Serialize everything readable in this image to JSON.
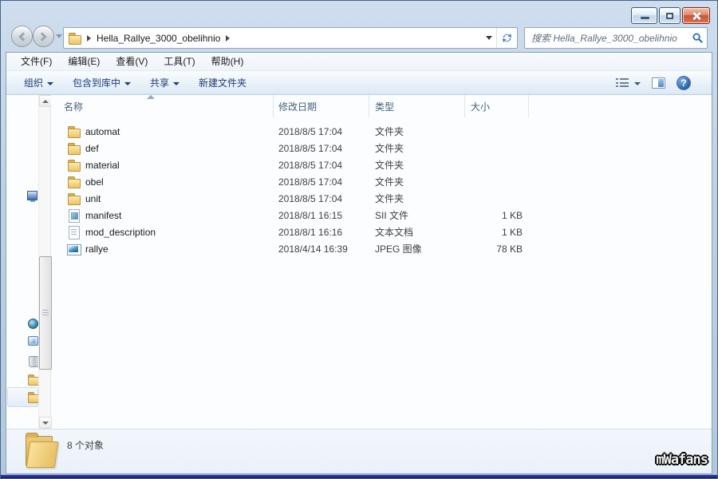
{
  "address_bar": {
    "breadcrumb_folder": "Hella_Rallye_3000_obelihnio"
  },
  "search": {
    "placeholder": "搜索 Hella_Rallye_3000_obelihnio"
  },
  "menu_bar": {
    "items": [
      "文件(F)",
      "编辑(E)",
      "查看(V)",
      "工具(T)",
      "帮助(H)"
    ]
  },
  "toolbar": {
    "organize": "组织",
    "include_in_library": "包含到库中",
    "share": "共享",
    "new_folder": "新建文件夹"
  },
  "columns": {
    "name": "名称",
    "date_modified": "修改日期",
    "type": "类型",
    "size": "大小"
  },
  "files": [
    {
      "name": "automat",
      "date": "2018/8/5 17:04",
      "type": "文件夹",
      "size": "",
      "icon": "folder"
    },
    {
      "name": "def",
      "date": "2018/8/5 17:04",
      "type": "文件夹",
      "size": "",
      "icon": "folder"
    },
    {
      "name": "material",
      "date": "2018/8/5 17:04",
      "type": "文件夹",
      "size": "",
      "icon": "folder"
    },
    {
      "name": "obel",
      "date": "2018/8/5 17:04",
      "type": "文件夹",
      "size": "",
      "icon": "folder"
    },
    {
      "name": "unit",
      "date": "2018/8/5 17:04",
      "type": "文件夹",
      "size": "",
      "icon": "folder"
    },
    {
      "name": "manifest",
      "date": "2018/8/1 16:15",
      "type": "SII 文件",
      "size": "1 KB",
      "icon": "sii"
    },
    {
      "name": "mod_description",
      "date": "2018/8/1 16:16",
      "type": "文本文档",
      "size": "1 KB",
      "icon": "text"
    },
    {
      "name": "rallye",
      "date": "2018/4/14 16:39",
      "type": "JPEG 图像",
      "size": "78 KB",
      "icon": "image"
    }
  ],
  "status_bar": {
    "item_count": "8 个对象"
  },
  "watermark": {
    "text": "mWafans"
  },
  "colors": {
    "close_button": "#c9553d",
    "accent_blue": "#2f6fc1",
    "folder_yellow": "#ecc468"
  }
}
